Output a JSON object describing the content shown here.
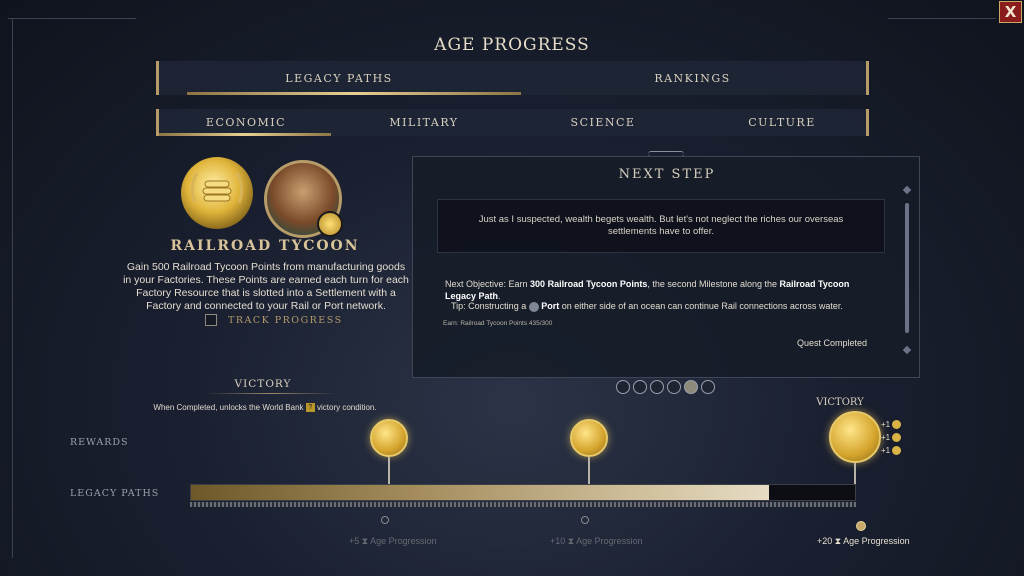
{
  "window": {
    "title": "AGE PROGRESS",
    "close_label": "X"
  },
  "main_tabs": [
    {
      "label": "LEGACY PATHS",
      "selected": true
    },
    {
      "label": "RANKINGS",
      "selected": false
    }
  ],
  "sub_tabs": [
    {
      "label": "ECONOMIC",
      "selected": true
    },
    {
      "label": "MILITARY",
      "selected": false
    },
    {
      "label": "SCIENCE",
      "selected": false
    },
    {
      "label": "CULTURE",
      "selected": false
    }
  ],
  "legacy": {
    "name": "RAILROAD TYCOON",
    "description_lines": [
      "Gain 500 Railroad Tycoon Points from manufacturing goods",
      "in your Factories. These Points are earned each turn for each",
      "Factory Resource that is slotted into a Settlement with a",
      "Factory and connected to your Rail or Port network."
    ],
    "track_label": "TRACK PROGRESS",
    "track_checked": false,
    "icons": [
      "coin-stack-laurel-icon",
      "advisor-portrait-icon"
    ]
  },
  "victory": {
    "heading": "VICTORY",
    "text_before": "When Completed, unlocks the World Bank",
    "text_after": "victory condition."
  },
  "next_step": {
    "title": "NEXT STEP",
    "quote": "Just as I suspected, wealth begets wealth. But let's not neglect the riches our overseas settlements have to offer.",
    "objective_prefix": "Next Objective: Earn ",
    "objective_bold": "300 Railroad Tycoon Points",
    "objective_mid": ", the second Milestone along the ",
    "objective_bold2": "Railroad Tycoon",
    "objective_line2": "Legacy Path",
    "objective_end": ".",
    "tip_prefix": "Tip: Constructing a ",
    "tip_bold": "Port",
    "tip_rest": " on either side of an ocean can continue Rail connections across water.",
    "earn_text": "Earn: Railroad Tycoon Points 435/300",
    "status": "Quest Completed",
    "page_dots": 6,
    "active_dot": 5
  },
  "rewards_label": "REWARDS",
  "legacy_paths_label": "LEGACY PATHS",
  "victory_reward_label": "VICTORY",
  "victory_bonuses": [
    "+1",
    "+1",
    "+1"
  ],
  "progress": {
    "value": 435,
    "max": 500,
    "milestones": [
      {
        "points": 100,
        "label_value": "+5",
        "label": "Age Progression",
        "reached": false
      },
      {
        "points": 300,
        "label_value": "+10",
        "label": "Age Progression",
        "reached": false
      },
      {
        "points": 500,
        "label_value": "+20",
        "label": "Age Progression",
        "reached": true
      }
    ]
  },
  "colors": {
    "accent_gold": "#c9a86a",
    "close_red": "#8a1c1c"
  }
}
